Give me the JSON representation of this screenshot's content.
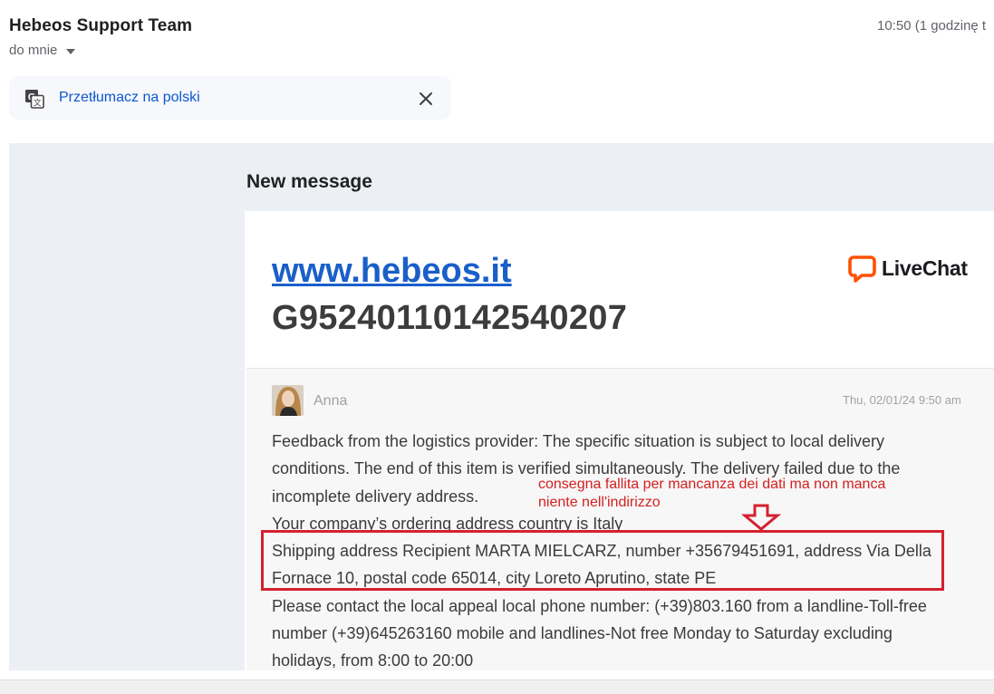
{
  "header": {
    "sender": "Hebeos Support Team",
    "recipient": "do mnie",
    "time": "10:50 (1 godzinę t"
  },
  "translate": {
    "label": "Przetłumacz na polski",
    "close_icon": "close-icon",
    "translate_icon": "translate-icon"
  },
  "email": {
    "heading": "New message",
    "site_link": "www.hebeos.it",
    "ticket_id": "G95240110142540207",
    "logo_text": "LiveChat",
    "chat": {
      "agent": "Anna",
      "timestamp": "Thu, 02/01/24 9:50 am",
      "paragraphs": [
        "Feedback from the logistics provider: The specific situation is subject to local delivery conditions. The end of this item is verified simultaneously. The delivery failed due to the incomplete delivery address.",
        "Your company’s ordering address country is Italy",
        "Shipping address Recipient MARTA MIELCARZ, number +35679451691, address Via Della Fornace 10, postal code 65014, city Loreto Aprutino, state PE",
        "Please contact the local appeal local phone number: (+39)803.160 from a landline-Toll-free number (+39)645263160 mobile and landlines-Not free Monday to Saturday excluding holidays, from 8:00 to 20:00"
      ]
    },
    "annotation": {
      "text": "consegna fallita per mancanza dei dati ma non manca niente nell'indirizzo",
      "color": "#d42020"
    }
  },
  "colors": {
    "link": "#1a5fc9",
    "translate_link": "#0b57d0",
    "highlight": "#d42130",
    "livechat_orange": "#ff5100"
  }
}
